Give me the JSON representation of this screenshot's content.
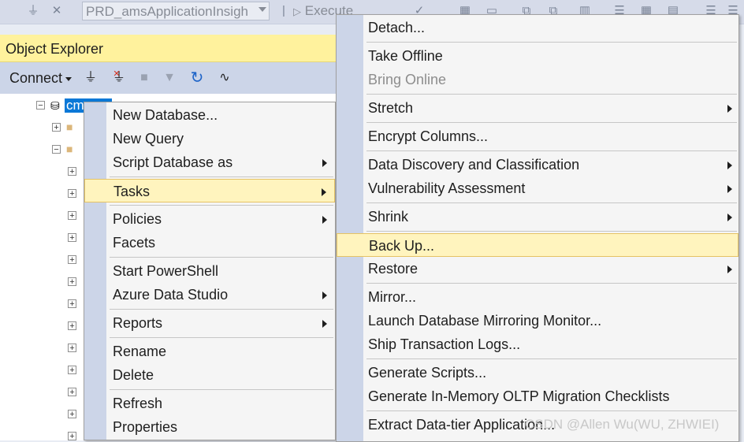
{
  "toolbar": {
    "database_combo": "PRD_amsApplicationInsigh",
    "execute_label": "Execute"
  },
  "object_explorer": {
    "title": "Object Explorer",
    "connect_label": "Connect",
    "selected_node_label": "cm"
  },
  "context_menu": {
    "items": [
      {
        "label": "New Database...",
        "submenu": false
      },
      {
        "label": "New Query",
        "submenu": false
      },
      {
        "label": "Script Database as",
        "submenu": true
      },
      {
        "label": "Tasks",
        "submenu": true,
        "highlighted": true
      },
      {
        "label": "Policies",
        "submenu": true
      },
      {
        "label": "Facets",
        "submenu": false
      },
      {
        "label": "Start PowerShell",
        "submenu": false
      },
      {
        "label": "Azure Data Studio",
        "submenu": true
      },
      {
        "label": "Reports",
        "submenu": true
      },
      {
        "label": "Rename",
        "submenu": false
      },
      {
        "label": "Delete",
        "submenu": false
      },
      {
        "label": "Refresh",
        "submenu": false
      },
      {
        "label": "Properties",
        "submenu": false
      }
    ]
  },
  "tasks_menu": {
    "items": [
      {
        "label": "Detach...",
        "submenu": false
      },
      {
        "label": "Take Offline",
        "submenu": false
      },
      {
        "label": "Bring Online",
        "submenu": false,
        "disabled": true
      },
      {
        "label": "Stretch",
        "submenu": true
      },
      {
        "label": "Encrypt Columns...",
        "submenu": false
      },
      {
        "label": "Data Discovery and Classification",
        "submenu": true
      },
      {
        "label": "Vulnerability Assessment",
        "submenu": true
      },
      {
        "label": "Shrink",
        "submenu": true
      },
      {
        "label": "Back Up...",
        "submenu": false,
        "highlighted": true
      },
      {
        "label": "Restore",
        "submenu": true
      },
      {
        "label": "Mirror...",
        "submenu": false
      },
      {
        "label": "Launch Database Mirroring Monitor...",
        "submenu": false
      },
      {
        "label": "Ship Transaction Logs...",
        "submenu": false
      },
      {
        "label": "Generate Scripts...",
        "submenu": false
      },
      {
        "label": "Generate In-Memory OLTP Migration Checklists",
        "submenu": false
      },
      {
        "label": "Extract Data-tier Application...",
        "submenu": false
      }
    ]
  },
  "watermark": "CSDN @Allen Wu(WU, ZHWIEI)",
  "colors": {
    "highlight_bg": "#fff4be",
    "highlight_border": "#e5c365",
    "oe_header": "#fff29d",
    "selected_node": "#0a78d7",
    "menu_gutter": "#ccd5e8"
  }
}
